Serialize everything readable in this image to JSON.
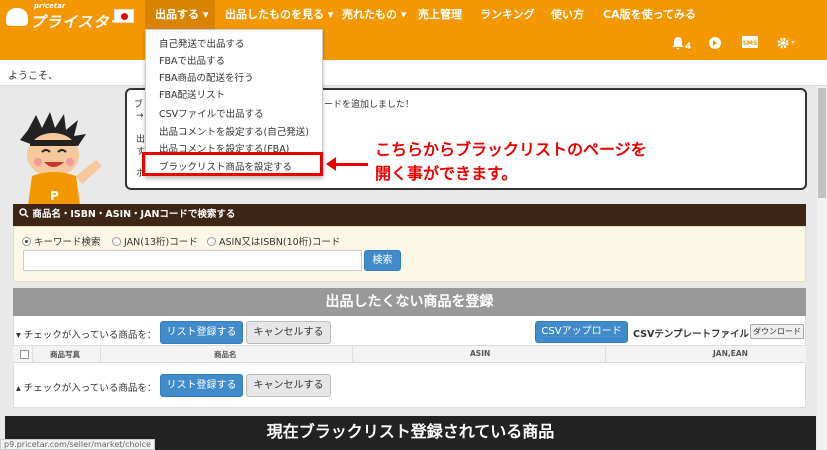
{
  "brand": {
    "tagline": "pricetar",
    "name": "プライスター"
  },
  "nav": {
    "items": [
      {
        "label": "出品する ▾"
      },
      {
        "label": "出品したものを見る ▾"
      },
      {
        "label": "売れたもの ▾"
      },
      {
        "label": "売上管理"
      },
      {
        "label": "ランキング"
      },
      {
        "label": "使い方"
      },
      {
        "label": "CA版を使ってみる"
      }
    ],
    "icons": [
      "bell-icon",
      "settings-circle-icon",
      "mail-icon",
      "gear-icon"
    ],
    "notification_count": "4"
  },
  "welcome": "ようこそ、",
  "dropdown": {
    "items": [
      "自己発送で出品する",
      "FBAで出品する",
      "FBA商品の配送を行う",
      "FBA配送リスト",
      "CSVファイルで出品する",
      "出品コメントを設定する(自己発送)",
      "出品コメントを設定する(FBA)",
      "ブラックリスト商品を設定する"
    ]
  },
  "speech": {
    "line1_left": "ブ",
    "line1_right": "ードを追加しました！",
    "line2": "→",
    "line3": "出",
    "line4": "す",
    "line5": "ホ"
  },
  "annotation": {
    "line1": "こちらからブラックリストのページを",
    "line2": "開く事ができます。"
  },
  "search": {
    "header": "商品名・ISBN・ASIN・JANコードで検索する",
    "options": [
      "キーワード検索",
      "JAN(13桁)コード",
      "ASIN又はISBN(10桁)コード"
    ],
    "selected": "キーワード検索",
    "input_value": "",
    "button": "検索"
  },
  "blacklist_panel": {
    "title": "出品したくない商品を登録",
    "checked_label": "チェックが入っている商品を：",
    "register_button": "リスト登録する",
    "cancel_button": "キャンセルする",
    "csv_upload_button": "CSVアップロード",
    "csv_template_label": "CSVテンプレートファイル",
    "download_button": "ダウンロード",
    "columns": [
      "商品写真",
      "商品名",
      "ASIN",
      "JAN,EAN"
    ]
  },
  "current_section_title": "現在ブラックリスト登録されている商品",
  "status_url": "p9.pricetar.com/seller/market/choice",
  "colors": {
    "nav": "#f39800",
    "accent_red": "#e00000",
    "button_blue": "#428bca",
    "search_header": "#3d2615"
  }
}
